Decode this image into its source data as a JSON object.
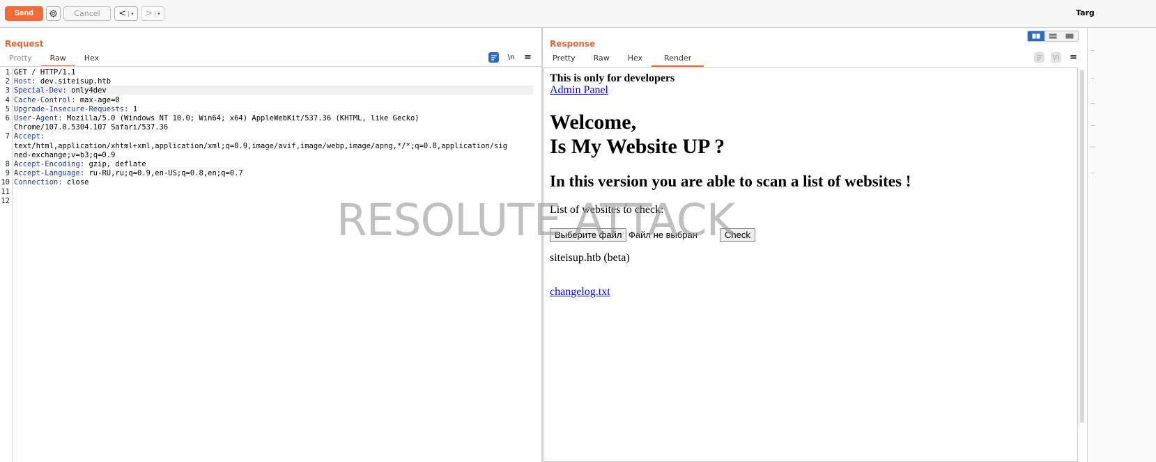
{
  "toolbar": {
    "send_label": "Send",
    "cancel_label": "Cancel",
    "back_glyph": "<",
    "forward_glyph": ">",
    "dropdown_glyph": "▾",
    "target_label": "Targ"
  },
  "request": {
    "title": "Request",
    "tabs": [
      "Pretty",
      "Raw",
      "Hex"
    ],
    "active_tab": "Raw",
    "lines": [
      {
        "n": "1",
        "key": "",
        "val": "GET / HTTP/1.1"
      },
      {
        "n": "2",
        "key": "Host:",
        "val": " dev.siteisup.htb"
      },
      {
        "n": "3",
        "key": "Special-Dev:",
        "val": " only4dev"
      },
      {
        "n": "4",
        "key": "Cache-Control:",
        "val": " max-age=0"
      },
      {
        "n": "5",
        "key": "Upgrade-Insecure-Requests:",
        "val": " 1"
      },
      {
        "n": "6",
        "key": "User-Agent:",
        "val": " Mozilla/5.0 (Windows NT 10.0; Win64; x64) AppleWebKit/537.36 (KHTML, like Gecko)"
      },
      {
        "n": "",
        "key": "",
        "val": "Chrome/107.0.5304.107 Safari/537.36"
      },
      {
        "n": "7",
        "key": "Accept:",
        "val": ""
      },
      {
        "n": "",
        "key": "",
        "val": "text/html,application/xhtml+xml,application/xml;q=0.9,image/avif,image/webp,image/apng,*/*;q=0.8,application/sig"
      },
      {
        "n": "",
        "key": "",
        "val": "ned-exchange;v=b3;q=0.9"
      },
      {
        "n": "8",
        "key": "Accept-Encoding:",
        "val": " gzip, deflate"
      },
      {
        "n": "9",
        "key": "Accept-Language:",
        "val": " ru-RU,ru;q=0.9,en-US;q=0.8,en;q=0.7"
      },
      {
        "n": "10",
        "key": "Connection:",
        "val": " close"
      },
      {
        "n": "11",
        "key": "",
        "val": ""
      },
      {
        "n": "12",
        "key": "",
        "val": ""
      }
    ],
    "icons": {
      "wrap": "\\n",
      "menu": "≡"
    }
  },
  "response": {
    "title": "Response",
    "tabs": [
      "Pretty",
      "Raw",
      "Hex",
      "Render"
    ],
    "active_tab": "Render",
    "icons": {
      "wrap": "\\n",
      "menu": "≡"
    },
    "render": {
      "dev_note": "This is only for developers",
      "admin_link": "Admin Panel",
      "welcome_line1": "Welcome,",
      "welcome_line2": "Is My Website UP ?",
      "subheading": "In this version you are able to scan a list of websites !",
      "list_label": "List of websites to check:",
      "file_button": "Выберите файл",
      "no_file": "Файл не выбран",
      "check_button": "Check",
      "beta": "siteisup.htb (beta)",
      "changelog_link": "changelog.txt"
    }
  },
  "watermark": "RESOLUTE ATTACK",
  "colors": {
    "accent": "#f26a35",
    "active_blue": "#2a6cc4",
    "link": "#0000ee",
    "header_key": "#1f3a8a"
  }
}
